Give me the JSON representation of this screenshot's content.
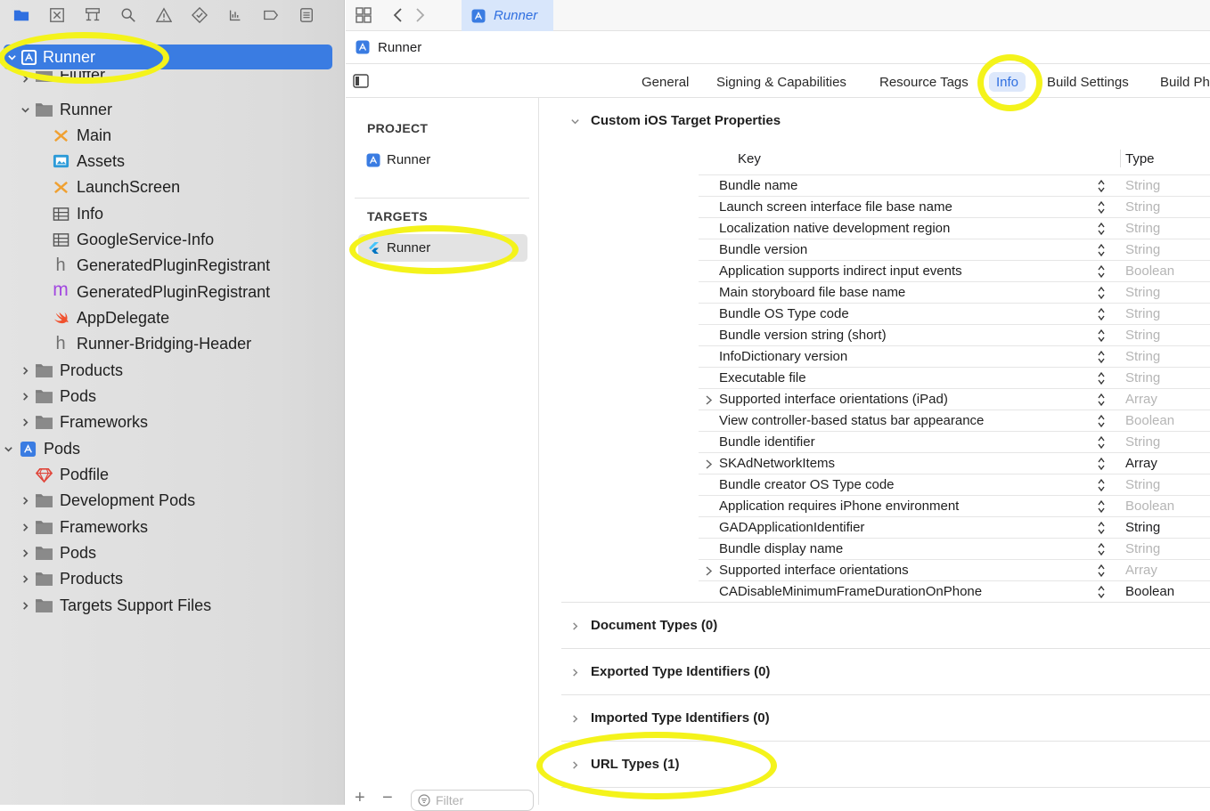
{
  "navigator": {
    "tree": [
      {
        "label": "Runner",
        "icon": "xcode-project-icon",
        "expanded": true,
        "selected": true
      },
      {
        "label": "Flutter",
        "icon": "folder-icon",
        "expanded": false
      },
      {
        "label": "Runner",
        "icon": "folder-icon",
        "expanded": true
      },
      {
        "label": "Main",
        "icon": "storyboard-icon"
      },
      {
        "label": "Assets",
        "icon": "asset-catalog-icon"
      },
      {
        "label": "LaunchScreen",
        "icon": "storyboard-icon"
      },
      {
        "label": "Info",
        "icon": "plist-icon"
      },
      {
        "label": "GoogleService-Info",
        "icon": "plist-icon"
      },
      {
        "label": "GeneratedPluginRegistrant",
        "icon": "header-file-icon"
      },
      {
        "label": "GeneratedPluginRegistrant",
        "icon": "objc-file-icon"
      },
      {
        "label": "AppDelegate",
        "icon": "swift-file-icon"
      },
      {
        "label": "Runner-Bridging-Header",
        "icon": "header-file-icon"
      },
      {
        "label": "Products",
        "icon": "folder-icon",
        "expanded": false
      },
      {
        "label": "Pods",
        "icon": "folder-icon",
        "expanded": false
      },
      {
        "label": "Frameworks",
        "icon": "folder-icon",
        "expanded": false
      },
      {
        "label": "Pods",
        "icon": "xcode-project-icon",
        "expanded": true
      },
      {
        "label": "Podfile",
        "icon": "ruby-file-icon"
      },
      {
        "label": "Development Pods",
        "icon": "folder-icon",
        "expanded": false
      },
      {
        "label": "Frameworks",
        "icon": "folder-icon",
        "expanded": false
      },
      {
        "label": "Pods",
        "icon": "folder-icon",
        "expanded": false
      },
      {
        "label": "Products",
        "icon": "folder-icon",
        "expanded": false
      },
      {
        "label": "Targets Support Files",
        "icon": "folder-icon",
        "expanded": false
      }
    ]
  },
  "editor": {
    "active_tab": "Runner",
    "jump_bar": "Runner",
    "tabs": [
      "General",
      "Signing & Capabilities",
      "Resource Tags",
      "Info",
      "Build Settings",
      "Build Ph"
    ],
    "selected_tab": "Info"
  },
  "targets_pane": {
    "project_header": "PROJECT",
    "project_item": "Runner",
    "targets_header": "TARGETS",
    "target_item": "Runner",
    "filter_placeholder": "Filter",
    "add_symbol": "+",
    "remove_symbol": "−"
  },
  "info": {
    "custom_section_title": "Custom iOS Target Properties",
    "key_header": "Key",
    "type_header": "Type",
    "properties": [
      {
        "key": "Bundle name",
        "type": "String",
        "dim": true
      },
      {
        "key": "Launch screen interface file base name",
        "type": "String",
        "dim": true
      },
      {
        "key": "Localization native development region",
        "type": "String",
        "dim": true
      },
      {
        "key": "Bundle version",
        "type": "String",
        "dim": true
      },
      {
        "key": "Application supports indirect input events",
        "type": "Boolean",
        "dim": true
      },
      {
        "key": "Main storyboard file base name",
        "type": "String",
        "dim": true
      },
      {
        "key": "Bundle OS Type code",
        "type": "String",
        "dim": true
      },
      {
        "key": "Bundle version string (short)",
        "type": "String",
        "dim": true
      },
      {
        "key": "InfoDictionary version",
        "type": "String",
        "dim": true
      },
      {
        "key": "Executable file",
        "type": "String",
        "dim": true
      },
      {
        "key": "Supported interface orientations (iPad)",
        "type": "Array",
        "dim": true,
        "expandable": true
      },
      {
        "key": "View controller-based status bar appearance",
        "type": "Boolean",
        "dim": true
      },
      {
        "key": "Bundle identifier",
        "type": "String",
        "dim": true
      },
      {
        "key": "SKAdNetworkItems",
        "type": "Array",
        "dim": false,
        "expandable": true
      },
      {
        "key": "Bundle creator OS Type code",
        "type": "String",
        "dim": true
      },
      {
        "key": "Application requires iPhone environment",
        "type": "Boolean",
        "dim": true
      },
      {
        "key": "GADApplicationIdentifier",
        "type": "String",
        "dim": false
      },
      {
        "key": "Bundle display name",
        "type": "String",
        "dim": true
      },
      {
        "key": "Supported interface orientations",
        "type": "Array",
        "dim": true,
        "expandable": true
      },
      {
        "key": "CADisableMinimumFrameDurationOnPhone",
        "type": "Boolean",
        "dim": false
      }
    ],
    "collapsed_sections": [
      "Document Types (0)",
      "Exported Type Identifiers (0)",
      "Imported Type Identifiers (0)",
      "URL Types (1)"
    ]
  },
  "colors": {
    "selection": "#3a7ce2",
    "accent": "#2f6fe0",
    "highlight_ring": "#f4f31b",
    "dim_text": "#b5b5b5"
  }
}
